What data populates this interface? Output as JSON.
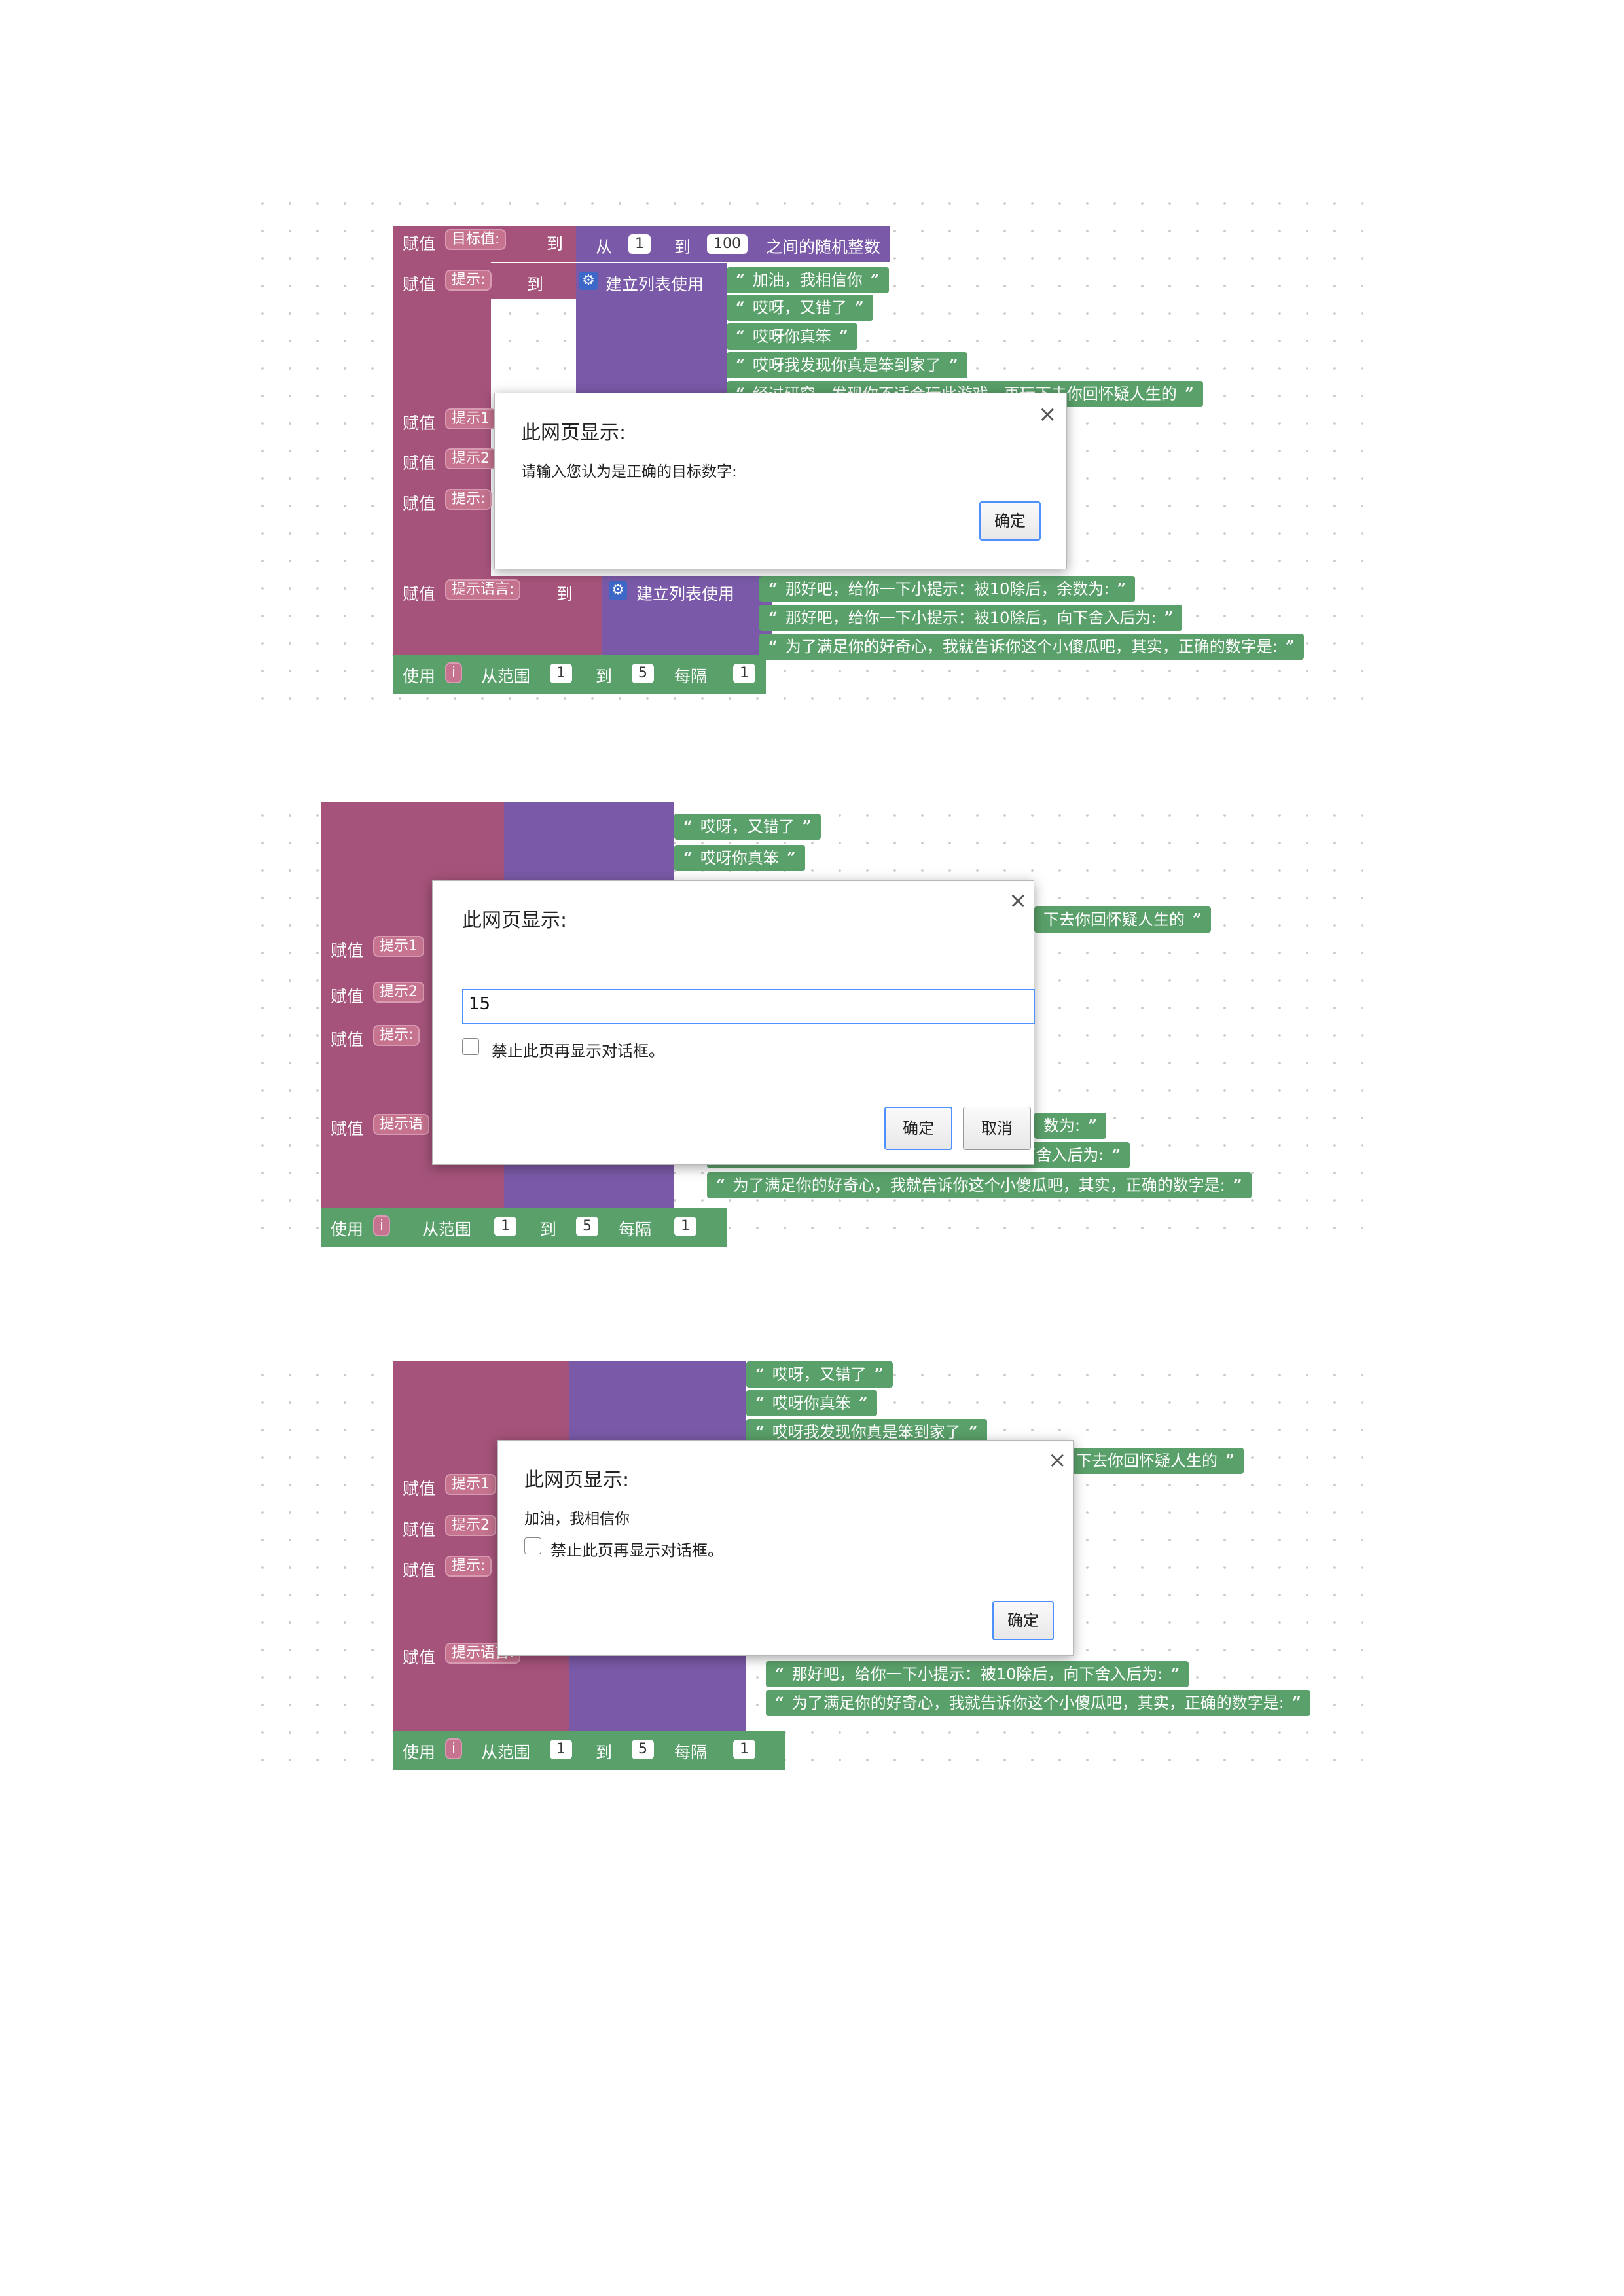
{
  "blocks": {
    "set_label": "赋值",
    "to_label": "到",
    "use_label": "使用",
    "range_label": "从范围",
    "step_label": "每隔",
    "from_label": "从",
    "random_label": "之间的随机整数",
    "build_list_label": "建立列表使用",
    "var_target": "目标值:",
    "var_tips": "提示:",
    "var_tip1": "提示1",
    "var_tip2": "提示2",
    "var_tip": "提示:",
    "var_tiplang": "提示语言:",
    "var_tiplang_cut": "提示语",
    "var_i": "i",
    "rand_from": "1",
    "rand_to": "100",
    "range_from": "1",
    "range_to": "5",
    "range_step": "1",
    "str1": "加油，我相信你",
    "str2": "哎呀，又错了",
    "str3": "哎呀你真笨",
    "str4": "哎呀我发现你真是笨到家了",
    "str5": "经过研究，发现你不适合玩此游戏，再玩下去你回怀疑人生的",
    "str5_cut": "下去你回怀疑人生的",
    "lang1": "那好吧，给你一下小提示：被10除后，余数为:",
    "lang1_cut": "数为:",
    "lang2": "那好吧，给你一下小提示：被10除后，向下舍入后为:",
    "lang3": "为了满足你的好奇心，我就告诉你这个小傻瓜吧，其实，正确的数字是:"
  },
  "dialogs": {
    "title": "此网页显示:",
    "close": "×",
    "dialog1": {
      "message": "请输入您认为是正确的目标数字:",
      "ok": "确定"
    },
    "dialog2": {
      "input_value": "15",
      "checkbox_label": "禁止此页再显示对话框。",
      "ok": "确定",
      "cancel": "取消"
    },
    "dialog3": {
      "message": "加油，我相信你",
      "checkbox_label": "禁止此页再显示对话框。",
      "ok": "确定"
    }
  },
  "colors": {
    "variable_block": "#a5537a",
    "list_block": "#7a5aa8",
    "text_block": "#5aa06a",
    "dialog_focus": "#4d90fe"
  }
}
